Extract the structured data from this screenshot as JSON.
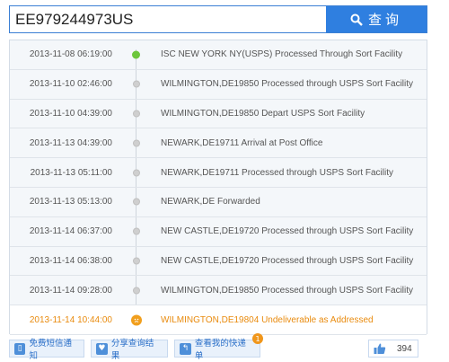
{
  "search": {
    "value": "EE979244973US",
    "button_label": "查询"
  },
  "tracking": [
    {
      "time": "2013-11-08 06:19:00",
      "desc": "ISC NEW YORK NY(USPS) Processed Through Sort Facility",
      "status": "first"
    },
    {
      "time": "2013-11-10 02:46:00",
      "desc": "WILMINGTON,DE19850 Processed through USPS Sort Facility",
      "status": "normal"
    },
    {
      "time": "2013-11-10 04:39:00",
      "desc": "WILMINGTON,DE19850 Depart USPS Sort Facility",
      "status": "normal"
    },
    {
      "time": "2013-11-13 04:39:00",
      "desc": "NEWARK,DE19711 Arrival at Post Office",
      "status": "normal"
    },
    {
      "time": "2013-11-13 05:11:00",
      "desc": "NEWARK,DE19711 Processed through USPS Sort Facility",
      "status": "normal"
    },
    {
      "time": "2013-11-13 05:13:00",
      "desc": "NEWARK,DE Forwarded",
      "status": "normal"
    },
    {
      "time": "2013-11-14 06:37:00",
      "desc": "NEW CASTLE,DE19720 Processed through USPS Sort Facility",
      "status": "normal"
    },
    {
      "time": "2013-11-14 06:38:00",
      "desc": "NEW CASTLE,DE19720 Processed through USPS Sort Facility",
      "status": "normal"
    },
    {
      "time": "2013-11-14 09:28:00",
      "desc": "WILMINGTON,DE19850 Processed through USPS Sort Facility",
      "status": "normal"
    },
    {
      "time": "2013-11-14 10:44:00",
      "desc": "WILMINGTON,DE19804 Undeliverable as Addressed",
      "status": "latest"
    }
  ],
  "actions": {
    "notify_label": "免费短信通知",
    "share_label": "分享查询结果",
    "my_express_label": "查看我的快递单",
    "my_express_badge": "1"
  },
  "like": {
    "count": "394"
  },
  "colors": {
    "accent": "#2f7fe0",
    "highlight": "#e98b0e",
    "first_dot": "#6cc63b"
  }
}
